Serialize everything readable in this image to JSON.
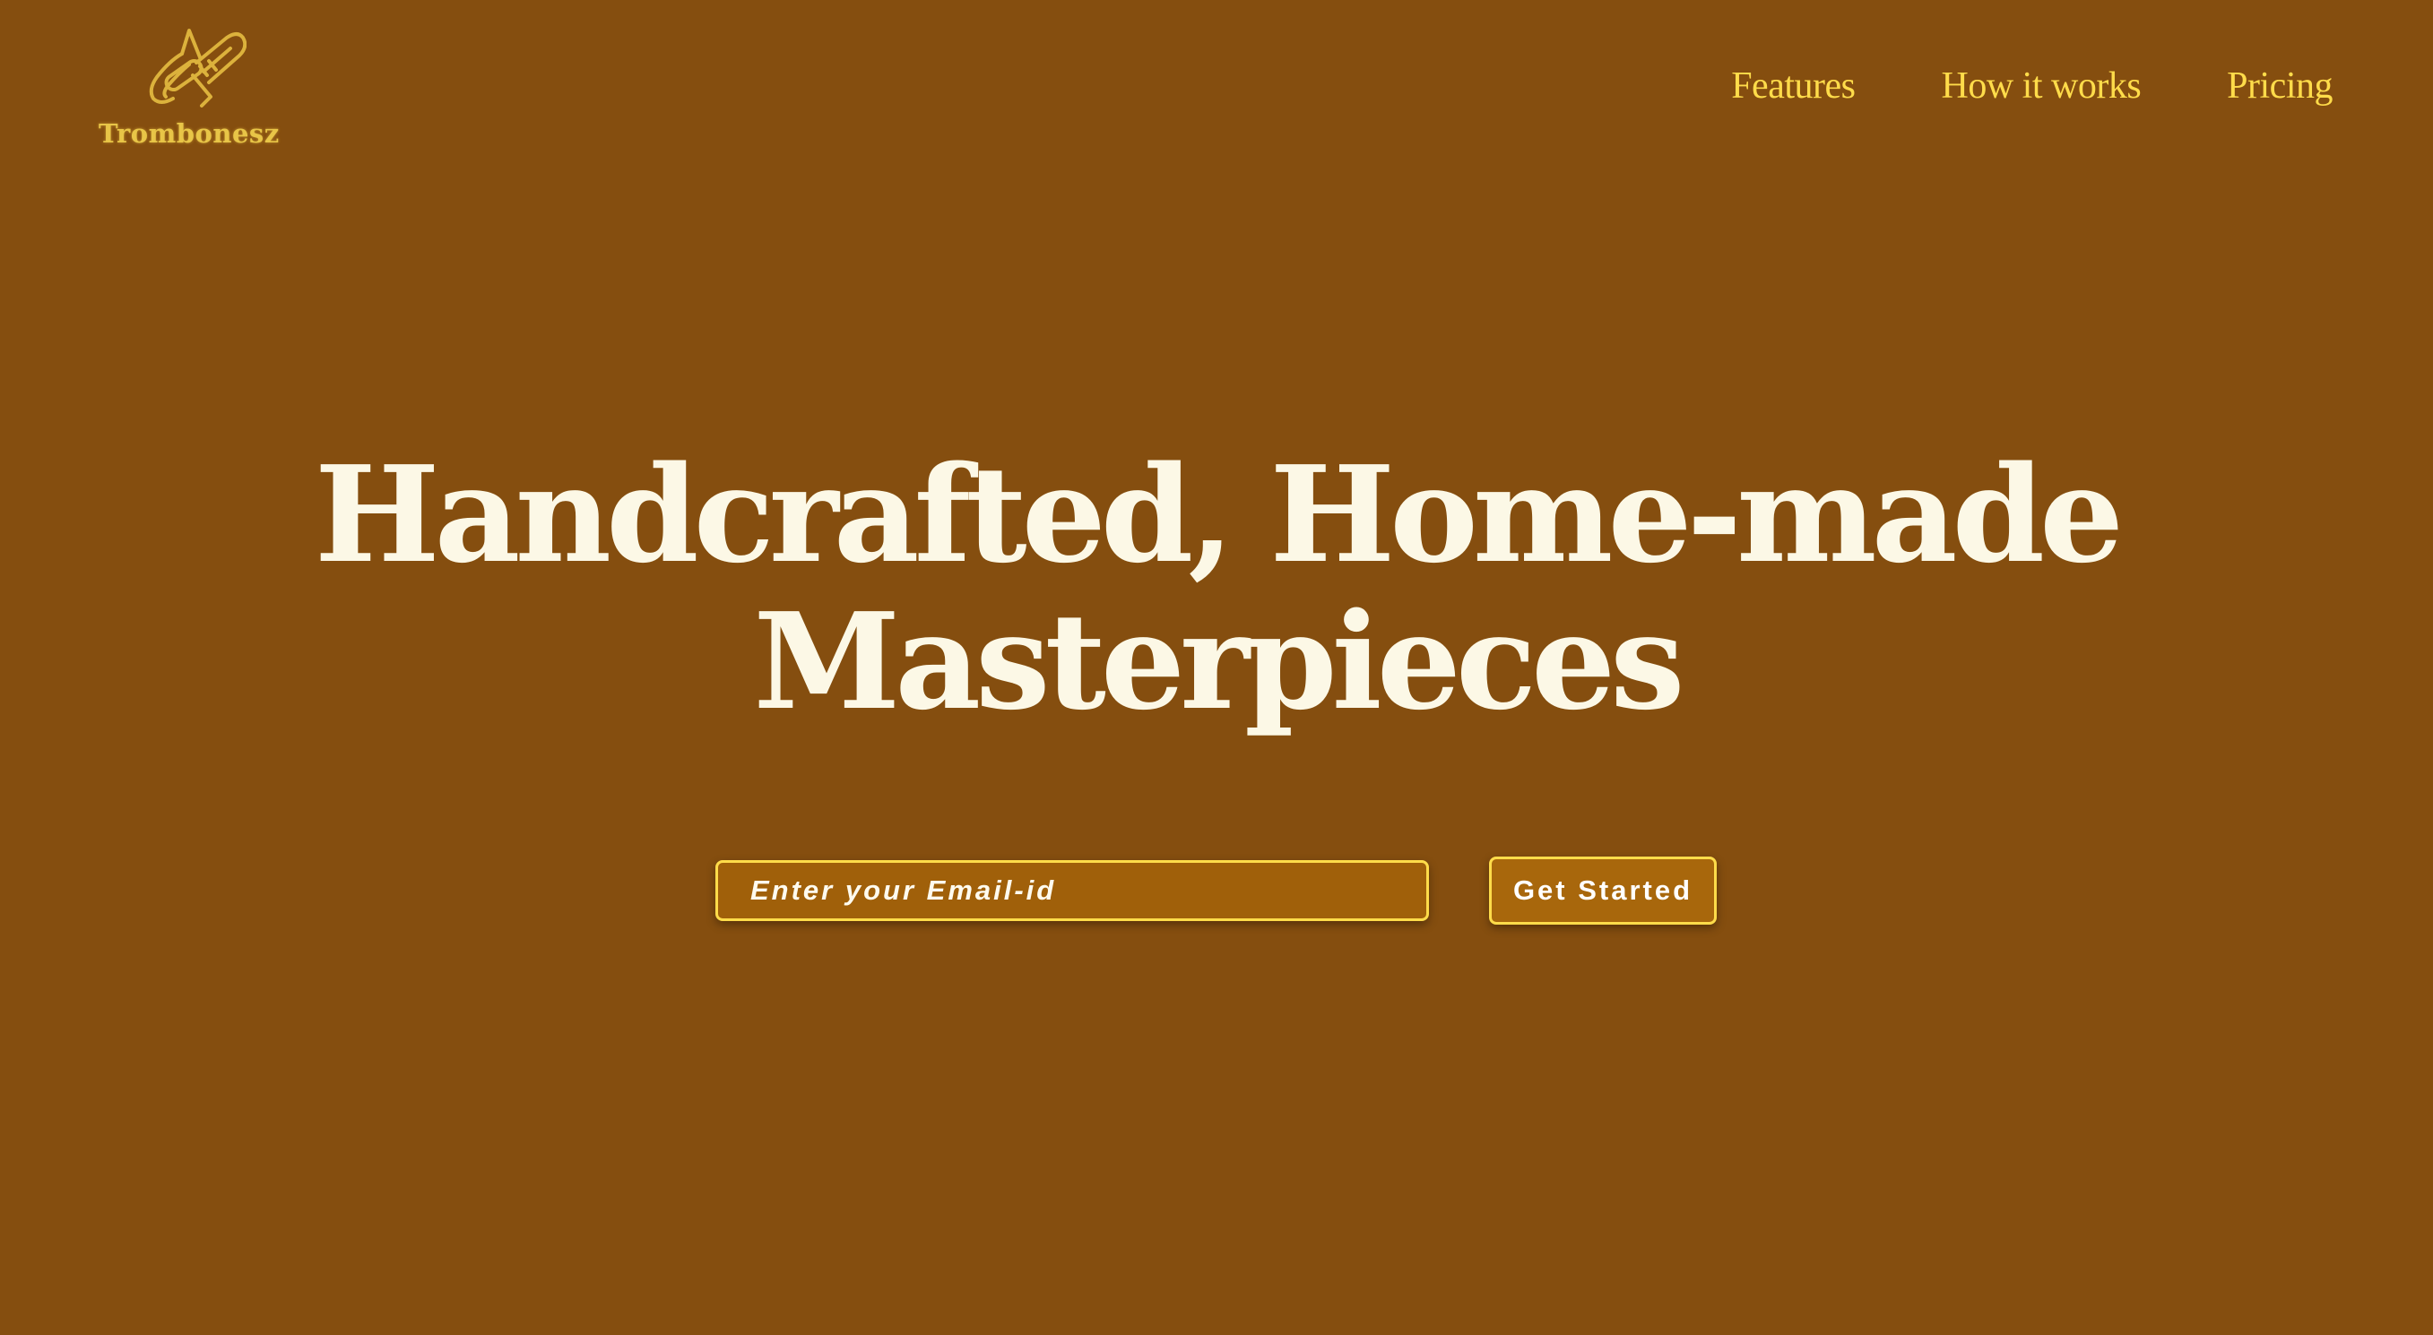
{
  "brand": {
    "name": "Trombonesz",
    "icon": "trombone-icon"
  },
  "nav": {
    "items": [
      {
        "label": "Features"
      },
      {
        "label": "How it works"
      },
      {
        "label": "Pricing"
      }
    ]
  },
  "hero": {
    "title_line1": "Handcrafted, Home-made",
    "title_line2": "Masterpieces"
  },
  "signup": {
    "email_placeholder": "Enter your Email-id",
    "email_value": "",
    "button_label": "Get Started"
  },
  "colors": {
    "background": "#854e0f",
    "accent": "#ffdc4a",
    "heading": "#fcf8e6",
    "input_fill": "#a0600a"
  }
}
